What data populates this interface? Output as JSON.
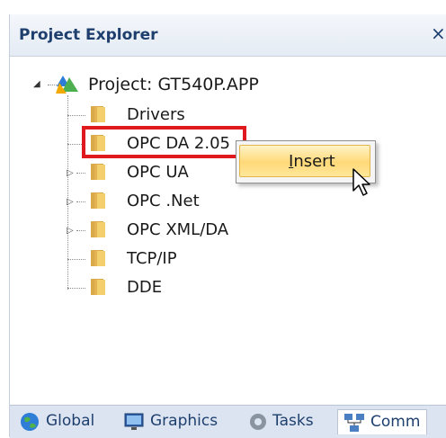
{
  "panel": {
    "title": "Project Explorer",
    "close_label": "×"
  },
  "tree": {
    "root": {
      "label": "Project: GT540P.APP",
      "expanded": true
    },
    "children": [
      {
        "label": "Drivers",
        "expandable": false
      },
      {
        "label": "OPC DA 2.05",
        "expandable": false,
        "highlighted": true
      },
      {
        "label": "OPC UA",
        "expandable": true
      },
      {
        "label": "OPC .Net",
        "expandable": true
      },
      {
        "label": "OPC XML/DA",
        "expandable": true
      },
      {
        "label": "TCP/IP",
        "expandable": false
      },
      {
        "label": "DDE",
        "expandable": false
      }
    ]
  },
  "context_menu": {
    "items": [
      {
        "label_underlined": "I",
        "label_rest": "nsert",
        "icon": "none"
      }
    ]
  },
  "tabs": [
    {
      "label": "Global",
      "icon": "globe-icon"
    },
    {
      "label": "Graphics",
      "icon": "monitor-icon"
    },
    {
      "label": "Tasks",
      "icon": "gear-icon"
    },
    {
      "label": "Comm",
      "icon": "network-icon",
      "active": true
    }
  ],
  "colors": {
    "highlight_border": "#e0191f",
    "title_text": "#1e3f6e",
    "menu_hover": "#ffd978"
  }
}
